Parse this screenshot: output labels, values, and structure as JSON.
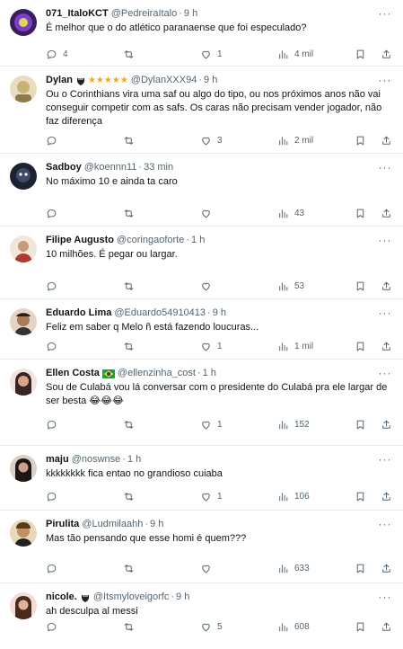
{
  "posts": [
    {
      "name": "071_ItaloKCT",
      "handle": "@PedreiraItalo",
      "time": "9 h",
      "text": "É melhor que o do atlético paranaense que foi especulado?",
      "replies": "4",
      "retweets": "",
      "likes": "1",
      "views": "4 mil",
      "avatar_color": "#4b2b7a",
      "badges": []
    },
    {
      "name": "Dylan",
      "handle": "@DylanXXX94",
      "time": "9 h",
      "text": "Ou o Corinthians vira uma saf ou algo do tipo, ou nos próximos anos não vai conseguir competir com as safs. Os caras não precisam vender jogador, não faz diferença",
      "replies": "",
      "retweets": "",
      "likes": "3",
      "views": "2 mil",
      "avatar_color": "#c9b277",
      "badges": [
        "corinthians-badge-icon",
        "star-icon"
      ],
      "stars": "★★★★★"
    },
    {
      "name": "Sadboy",
      "handle": "@koennn11",
      "time": "33 min",
      "text": "No máximo 10 e ainda ta caro",
      "replies": "",
      "retweets": "",
      "likes": "",
      "views": "43",
      "avatar_color": "#2a3140",
      "badges": []
    },
    {
      "name": "Filipe Augusto",
      "handle": "@coringaoforte",
      "time": "1 h",
      "text": "10 milhões. É pegar ou largar.",
      "replies": "",
      "retweets": "",
      "likes": "",
      "views": "53",
      "avatar_color": "#d9b48e",
      "badges": []
    },
    {
      "name": "Eduardo Lima",
      "handle": "@Eduardo54910413",
      "time": "9 h",
      "text": "Feliz em saber q Melo ñ está fazendo loucuras...",
      "replies": "",
      "retweets": "",
      "likes": "1",
      "views": "1 mil",
      "avatar_color": "#7a5a44",
      "badges": []
    },
    {
      "name": "Ellen Costa",
      "handle": "@ellenzinha_cost",
      "time": "1 h",
      "text": "Sou de Culabá vou lá conversar com o presidente do Culabá pra ele largar de ser besta 😂😂😂",
      "replies": "",
      "retweets": "",
      "likes": "1",
      "views": "152",
      "avatar_color": "#9c6b5a",
      "badges": [
        "brazil-flag-icon"
      ]
    },
    {
      "name": "maju",
      "handle": "@noswnse",
      "time": "1 h",
      "text": "kkkkkkkk fica entao no grandioso cuiaba",
      "replies": "",
      "retweets": "",
      "likes": "1",
      "views": "106",
      "avatar_color": "#3b2e2a",
      "badges": []
    },
    {
      "name": "Pirulita",
      "handle": "@Ludmilaahh",
      "time": "9 h",
      "text": "Mas tão pensando que esse homi é quem???",
      "replies": "",
      "retweets": "",
      "likes": "",
      "views": "633",
      "avatar_color": "#6b4a2e",
      "badges": []
    },
    {
      "name": "nicole.",
      "handle": "@Itsmyloveigorfc",
      "time": "9 h",
      "text": "ah desculpa al messi",
      "replies": "",
      "retweets": "",
      "likes": "5",
      "views": "608",
      "avatar_color": "#c98f7a",
      "badges": [
        "corinthians-badge-icon"
      ]
    }
  ],
  "separator": "·",
  "more_glyph": "···"
}
